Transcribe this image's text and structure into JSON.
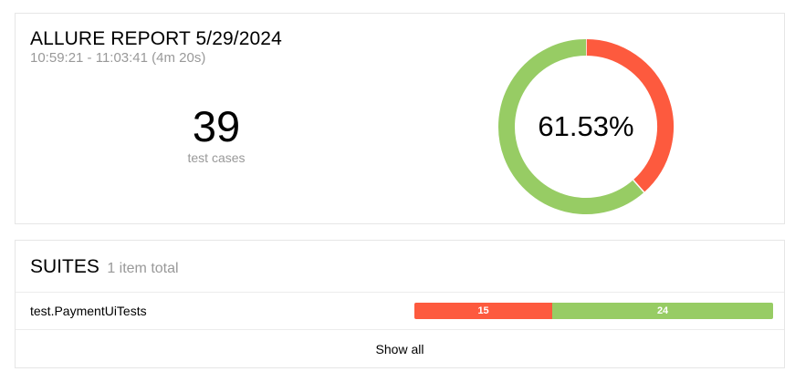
{
  "summary": {
    "title": "ALLURE REPORT 5/29/2024",
    "time_range": "10:59:21 - 11:03:41 (4m 20s)",
    "test_count": "39",
    "test_count_label": "test cases",
    "success_rate_label": "61.53%"
  },
  "suites": {
    "title": "SUITES",
    "count_label": "1 item total",
    "items": [
      {
        "name": "test.PaymentUiTests",
        "segments": [
          {
            "status": "failed",
            "label": "15",
            "value": 15,
            "color": "#fd5a3e"
          },
          {
            "status": "passed",
            "label": "24",
            "value": 24,
            "color": "#97cc64"
          }
        ]
      }
    ],
    "show_all_label": "Show all"
  },
  "chart_data": {
    "type": "pie",
    "categories": [
      "failed",
      "passed"
    ],
    "values": [
      15,
      24
    ],
    "colors": [
      "#fd5a3e",
      "#97cc64"
    ],
    "center_label": "61.53%"
  }
}
